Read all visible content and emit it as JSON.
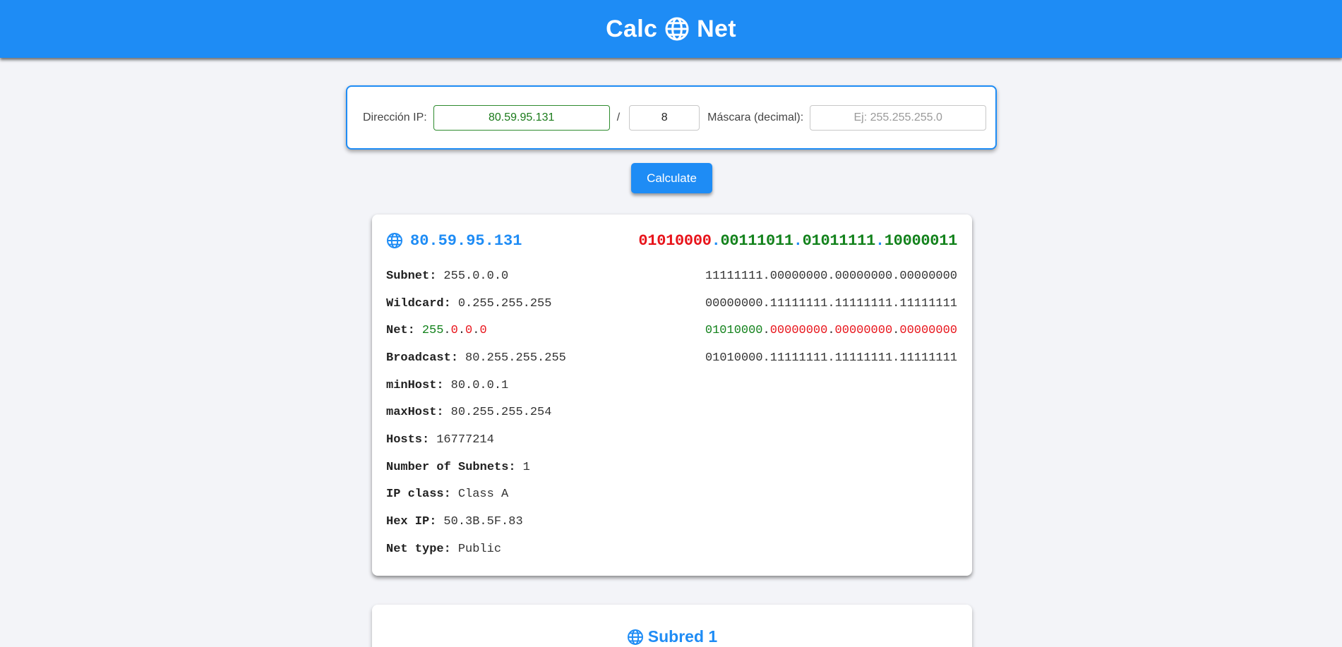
{
  "header": {
    "brand_left": "Calc",
    "brand_right": "Net",
    "brand_icon": "globe-icon"
  },
  "form": {
    "ip_label": "Dirección IP:",
    "ip_value": "80.59.95.131",
    "slash": "/",
    "prefix_value": "8",
    "mask_label": "Máscara (decimal):",
    "mask_placeholder": "Ej: 255.255.255.0",
    "mask_value": ""
  },
  "calculate_button": "Calculate",
  "result": {
    "ip": "80.59.95.131",
    "ip_binary": {
      "octets": [
        "01010000",
        "00111011",
        "01011111",
        "10000011"
      ],
      "dot": "."
    },
    "rows": [
      {
        "label": "Subnet:",
        "value": "255.0.0.0"
      },
      {
        "label": "Wildcard:",
        "value": "0.255.255.255"
      },
      {
        "label": "Net:",
        "value_parts": [
          "255",
          ".",
          "0",
          ".",
          "0",
          ".",
          "0"
        ]
      },
      {
        "label": "Broadcast:",
        "value": "80.255.255.255"
      },
      {
        "label": "minHost:",
        "value": "80.0.0.1"
      },
      {
        "label": "maxHost:",
        "value": "80.255.255.254"
      },
      {
        "label": "Hosts:",
        "value": "16777214"
      },
      {
        "label": "Number of Subnets:",
        "value": "1"
      },
      {
        "label": "IP class:",
        "value": "Class A"
      },
      {
        "label": "Hex IP:",
        "value": "50.3B.5F.83"
      },
      {
        "label": "Net type:",
        "value": "Public"
      }
    ],
    "binary_rows": {
      "subnet": "11111111.00000000.00000000.00000000",
      "wildcard": "00000000.11111111.11111111.11111111",
      "net_parts": [
        "01010000",
        ".",
        "00000000",
        ".",
        "00000000",
        ".",
        "00000000"
      ],
      "broadcast": "01010000.11111111.11111111.11111111"
    }
  },
  "subnet_card": {
    "title": "Subred 1"
  },
  "colors": {
    "accent": "#1e8cf5",
    "network_bits": "#13821c",
    "host_bits": "#e8141b",
    "background": "#f3f4f8"
  }
}
